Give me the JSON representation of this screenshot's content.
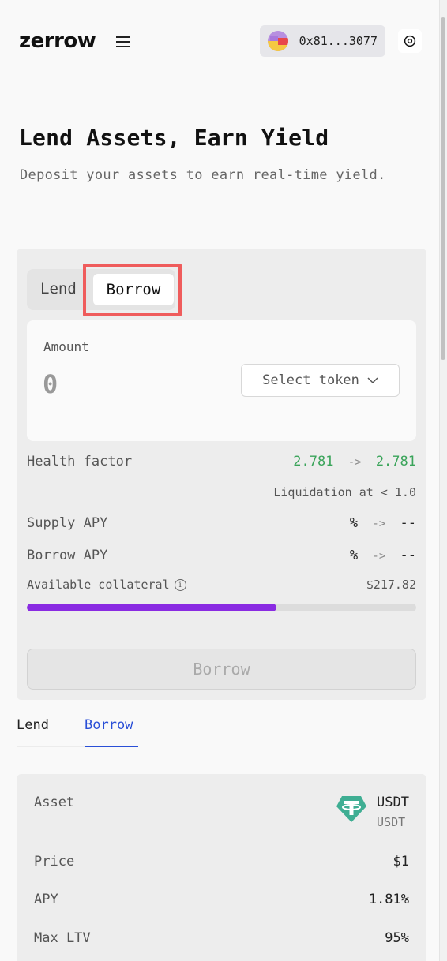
{
  "header": {
    "logo": "zerrow",
    "wallet_address": "0x81...3077"
  },
  "hero": {
    "title": "Lend Assets, Earn Yield",
    "subtitle": "Deposit your assets to earn real-time yield."
  },
  "form": {
    "tabs": [
      "Lend",
      "Borrow"
    ],
    "active_tab": "Borrow",
    "amount_label": "Amount",
    "amount_value": "0",
    "select_token_label": "Select token",
    "health_factor_label": "Health factor",
    "health_factor_from": "2.781",
    "health_factor_to": "2.781",
    "liquidation_note": "Liquidation at < 1.0",
    "supply_apy_label": "Supply APY",
    "supply_apy_from": "%",
    "supply_apy_to": "--",
    "borrow_apy_label": "Borrow APY",
    "borrow_apy_from": "%",
    "borrow_apy_to": "--",
    "collateral_label": "Available collateral",
    "collateral_value": "$217.82",
    "collateral_usage_fraction": 0.64,
    "submit_label": "Borrow",
    "arrow": "->"
  },
  "market_tabs": {
    "items": [
      "Lend",
      "Borrow"
    ],
    "active": "Borrow"
  },
  "asset": {
    "asset_label": "Asset",
    "symbol": "USDT",
    "subtitle": "USDT",
    "price_label": "Price",
    "price_value": "$1",
    "apy_label": "APY",
    "apy_value": "1.81%",
    "max_ltv_label": "Max LTV",
    "max_ltv_value": "95%"
  },
  "colors": {
    "accent_blue": "#2a4fd7",
    "health_green": "#3aa45a",
    "progress_purple": "#8a2be2",
    "highlight_red": "#ef5c5c",
    "usdt_teal": "#3fae93"
  }
}
